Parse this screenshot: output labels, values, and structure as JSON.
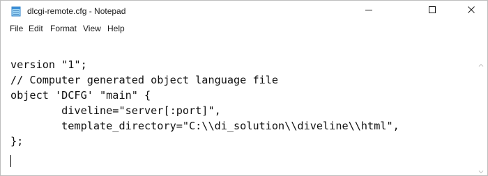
{
  "window": {
    "title": "dlcgi-remote.cfg - Notepad",
    "app_icon": "notepad-icon",
    "controls": {
      "minimize": "minimize-icon",
      "maximize": "maximize-icon",
      "close": "close-icon"
    }
  },
  "menu": {
    "items": [
      "File",
      "Edit",
      "Format",
      "View",
      "Help"
    ]
  },
  "editor": {
    "lines": [
      "version \"1\";",
      "// Computer generated object language file",
      "object 'DCFG' \"main\" {",
      "        diveline=\"server[:port]\",",
      "        template_directory=\"C:\\\\di_solution\\\\diveline\\\\html\",",
      "};"
    ]
  },
  "scrollbar": {
    "up_icon": "scroll-up-arrow-icon",
    "down_icon": "scroll-down-arrow-icon"
  }
}
